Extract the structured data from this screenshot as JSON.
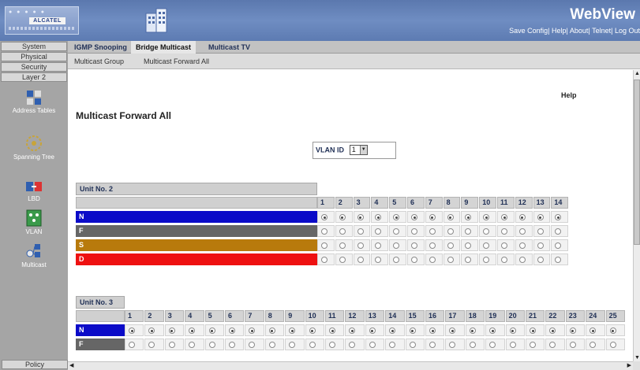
{
  "header": {
    "logo_text": "ALCATEL",
    "title": "WebView",
    "links": [
      "Save Config",
      "Help",
      "About",
      "Telnet",
      "Log Out"
    ],
    "separator": "|"
  },
  "leftnav": {
    "top_items": [
      "System",
      "Physical",
      "Security",
      "Layer 2"
    ],
    "icon_items": [
      {
        "label": "Address Tables",
        "icon": "address-tables-icon"
      },
      {
        "label": "Spanning Tree",
        "icon": "spanning-tree-icon"
      },
      {
        "label": "LBD",
        "icon": "lbd-icon"
      },
      {
        "label": "VLAN",
        "icon": "vlan-icon"
      },
      {
        "label": "Multicast",
        "icon": "multicast-icon"
      }
    ],
    "bottom_item": "Policy"
  },
  "tabs": [
    {
      "label": "IGMP Snooping",
      "active": false
    },
    {
      "label": "Bridge Multicast",
      "active": true
    },
    {
      "label": "Multicast TV",
      "active": false
    }
  ],
  "subtabs": [
    "Multicast Group",
    "Multicast Forward All"
  ],
  "content": {
    "help": "Help",
    "page_title": "Multicast Forward All",
    "vlan_label": "VLAN ID",
    "vlan_value": "1"
  },
  "units": [
    {
      "label": "Unit No. 2",
      "ports": [
        "1",
        "2",
        "3",
        "4",
        "5",
        "6",
        "7",
        "8",
        "9",
        "10",
        "11",
        "12",
        "13",
        "14"
      ],
      "rows": [
        {
          "label": "N",
          "color": "#0b0bc8",
          "selected": true
        },
        {
          "label": "F",
          "color": "#666666",
          "selected": false
        },
        {
          "label": "S",
          "color": "#b87a0c",
          "selected": false
        },
        {
          "label": "D",
          "color": "#ee1111",
          "selected": false
        }
      ]
    },
    {
      "label": "Unit No. 3",
      "ports": [
        "1",
        "2",
        "3",
        "4",
        "5",
        "6",
        "7",
        "8",
        "9",
        "10",
        "11",
        "12",
        "13",
        "14",
        "15",
        "16",
        "17",
        "18",
        "19",
        "20",
        "21",
        "22",
        "23",
        "24",
        "25"
      ],
      "rows": [
        {
          "label": "N",
          "color": "#0b0bc8",
          "selected": true
        },
        {
          "label": "F",
          "color": "#666666",
          "selected": false
        }
      ]
    }
  ],
  "colors": {
    "header_bg": "#6481b8",
    "nav_bg": "#a5a5a5"
  }
}
